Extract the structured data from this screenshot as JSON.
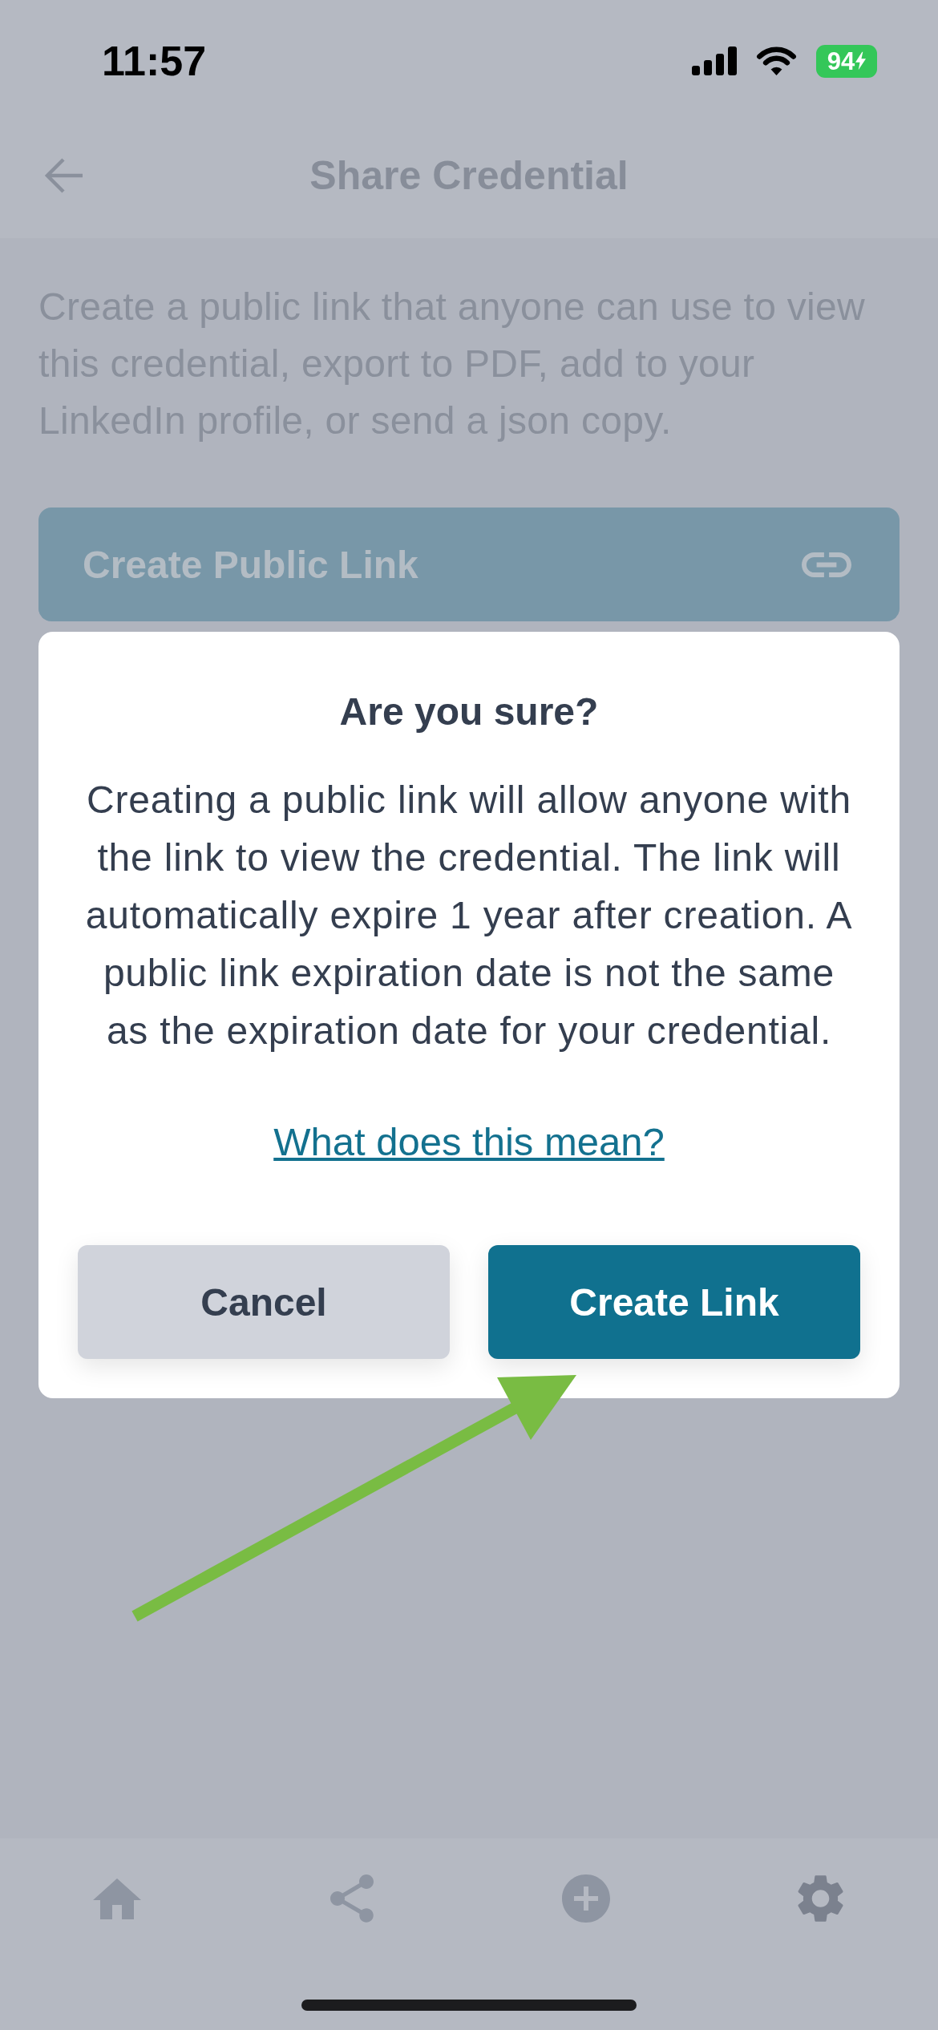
{
  "status_bar": {
    "time": "11:57",
    "battery": "94",
    "charging": true
  },
  "header": {
    "title": "Share Credential"
  },
  "description": "Create a public link that anyone can use to view this credential, export to PDF, add to your LinkedIn profile, or send a json copy.",
  "create_public_link_button": {
    "label": "Create Public Link"
  },
  "dialog": {
    "title": "Are you sure?",
    "message": "Creating a public link will allow anyone with the link to view the credential. The link will automatically expire 1 year after creation. A public link expiration date is not the same as the expiration date for your credential.",
    "help_link": "What does this mean?",
    "buttons": [
      {
        "label": "Cancel",
        "kind": "secondary"
      },
      {
        "label": "Create Link",
        "kind": "primary"
      }
    ]
  }
}
